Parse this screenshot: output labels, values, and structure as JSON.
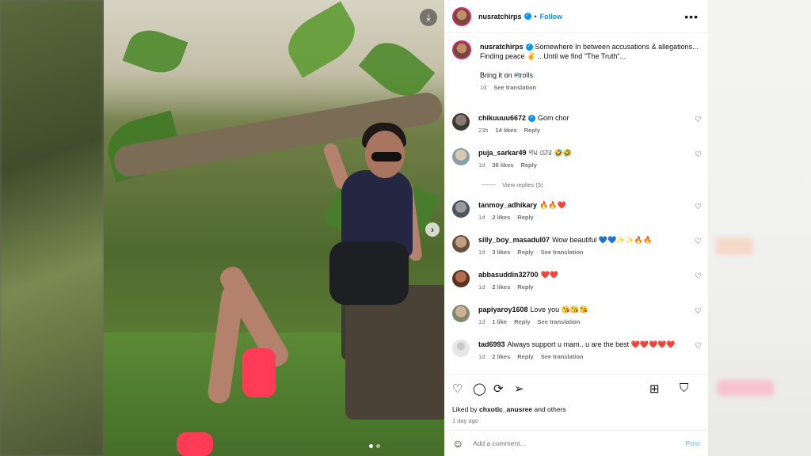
{
  "post": {
    "username": "nusratchirps",
    "follow_label": "Follow",
    "dot": "•",
    "more_icon": "more-horizontal-icon",
    "caption_line1": "Somewhere In between accusations & allegations...",
    "caption_line2": "Finding peace ✌️ .. Until we find \"The Truth\"...",
    "caption_line3_prefix": "Bring it on ",
    "caption_hashtag": "#trolls",
    "caption_age": "1d",
    "see_translation": "See translation"
  },
  "comments": [
    {
      "user": "chikuuuu6672",
      "verified": true,
      "text": "Gom chor",
      "age": "23h",
      "likes": "14 likes",
      "reply": "Reply",
      "translation": ""
    },
    {
      "user": "puja_sarkar49",
      "verified": false,
      "text": "গম চোর 🤣🤣",
      "age": "1d",
      "likes": "38 likes",
      "reply": "Reply",
      "translation": ""
    },
    {
      "user": "tanmoy_adhikary",
      "verified": false,
      "text": "🔥🔥❤️",
      "age": "1d",
      "likes": "2 likes",
      "reply": "Reply",
      "translation": ""
    },
    {
      "user": "silly_boy_masadul07",
      "verified": false,
      "text": "Wow beautiful 💙💙✨✨🔥🔥",
      "age": "1d",
      "likes": "3 likes",
      "reply": "Reply",
      "translation": "See translation"
    },
    {
      "user": "abbasuddin32700",
      "verified": false,
      "text": "❤️❤️",
      "age": "1d",
      "likes": "2 likes",
      "reply": "Reply",
      "translation": ""
    },
    {
      "user": "papiyaroy1608",
      "verified": false,
      "text": "Love you 😘😘😘",
      "age": "1d",
      "likes": "1 like",
      "reply": "Reply",
      "translation": "See translation"
    },
    {
      "user": "tad6993",
      "verified": false,
      "text": "Always support u mam.. u are the best ❤️❤️❤️❤️❤️",
      "age": "1d",
      "likes": "2 likes",
      "reply": "Reply",
      "translation": "See translation"
    }
  ],
  "view_replies": "View replies (5)",
  "actions": {
    "icons": [
      "heart-icon",
      "comment-icon",
      "repost-icon",
      "share-icon",
      "save-to-collection-icon",
      "bookmark-icon"
    ]
  },
  "likes": {
    "prefix": "Liked by ",
    "user": "chxotic_anusree",
    "suffix": " and others",
    "age": "1 day ago"
  },
  "comment_input": {
    "placeholder": "Add a comment...",
    "post_label": "Post"
  },
  "colors": {
    "accent": "#0095f6",
    "post_disabled": "#8cc8f7",
    "like_red": "#e02045"
  }
}
